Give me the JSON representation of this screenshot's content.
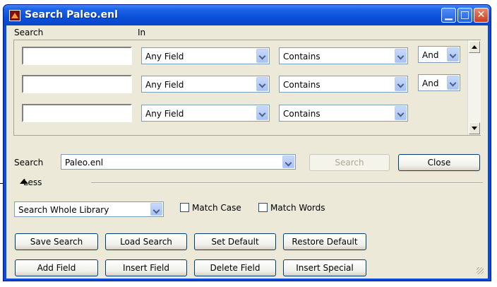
{
  "window": {
    "title": "Search Paleo.enl"
  },
  "headers": {
    "search": "Search",
    "in": "In"
  },
  "rows": [
    {
      "term": "",
      "field": "Any Field",
      "operator": "Contains",
      "bool": "And"
    },
    {
      "term": "",
      "field": "Any Field",
      "operator": "Contains",
      "bool": "And"
    },
    {
      "term": "",
      "field": "Any Field",
      "operator": "Contains"
    }
  ],
  "library": {
    "label": "Search",
    "value": "Paleo.enl"
  },
  "buttons": {
    "search": "Search",
    "close": "Close",
    "save_search": "Save Search",
    "load_search": "Load Search",
    "set_default": "Set Default",
    "restore_default": "Restore Default",
    "add_field": "Add Field",
    "insert_field": "Insert Field",
    "delete_field": "Delete Field",
    "insert_special": "Insert Special"
  },
  "less": "Less",
  "scope": {
    "value": "Search Whole Library"
  },
  "options": {
    "match_case": "Match Case",
    "match_words": "Match Words"
  },
  "icons": {
    "app": "endnote-library-icon",
    "less_toggle": "arrow-up-icon"
  },
  "colors": {
    "titlebar": "#0a4fd9",
    "face": "#ece9d8",
    "close": "#c7401d"
  }
}
